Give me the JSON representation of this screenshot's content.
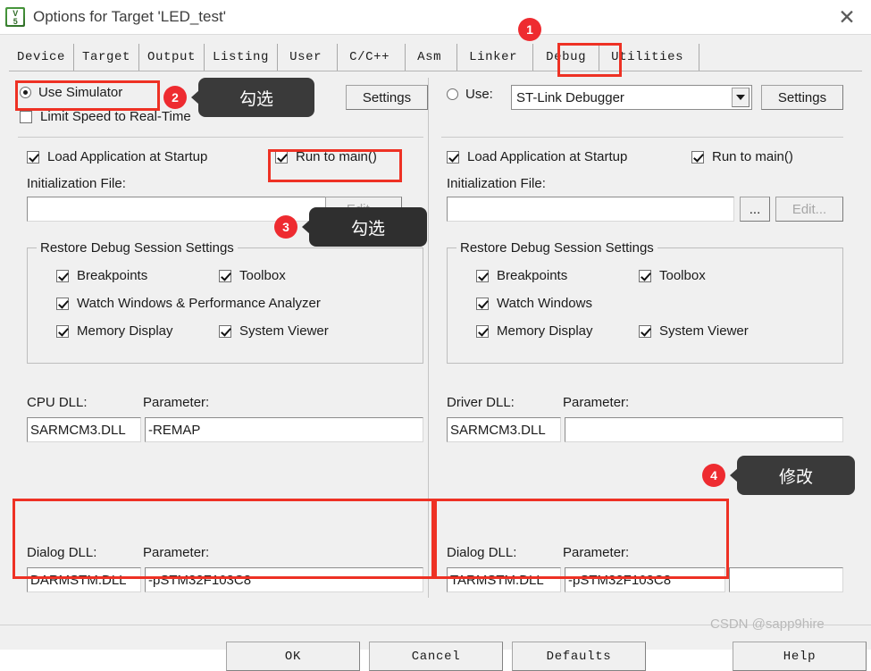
{
  "window": {
    "title": "Options for Target 'LED_test'",
    "app_icon": "keil-uvision-icon",
    "close_label": "✕"
  },
  "tabs": [
    {
      "label": "Device",
      "active": false
    },
    {
      "label": "Target",
      "active": false
    },
    {
      "label": "Output",
      "active": false
    },
    {
      "label": "Listing",
      "active": false
    },
    {
      "label": "User",
      "active": false
    },
    {
      "label": "C/C++",
      "active": false
    },
    {
      "label": "Asm",
      "active": false
    },
    {
      "label": "Linker",
      "active": false
    },
    {
      "label": "Debug",
      "active": true
    },
    {
      "label": "Utilities",
      "active": false
    }
  ],
  "left_panel": {
    "use_simulator": {
      "label": "Use Simulator",
      "checked": true
    },
    "limit_speed": {
      "label": "Limit Speed to Real-Time",
      "checked": false
    },
    "settings_button": "Settings",
    "load_app": {
      "label": "Load Application at Startup",
      "checked": true
    },
    "run_to_main": {
      "label": "Run to main()",
      "checked": true
    },
    "init_file_label": "Initialization File:",
    "init_file_value": "",
    "browse_button": "...",
    "edit_button": "Edit...",
    "restore_group": {
      "title": "Restore Debug Session Settings",
      "items": [
        {
          "label": "Breakpoints",
          "checked": true
        },
        {
          "label": "Toolbox",
          "checked": true
        },
        {
          "label": "Watch Windows & Performance Analyzer",
          "checked": true
        },
        {
          "label": "Memory Display",
          "checked": true
        },
        {
          "label": "System Viewer",
          "checked": true
        }
      ]
    },
    "cpu_dll_label": "CPU DLL:",
    "cpu_dll_value": "SARMCM3.DLL",
    "cpu_param_label": "Parameter:",
    "cpu_param_value": "-REMAP",
    "dialog_dll_label": "Dialog DLL:",
    "dialog_dll_value": "DARMSTM.DLL",
    "dialog_param_label": "Parameter:",
    "dialog_param_value": "-pSTM32F103C8"
  },
  "right_panel": {
    "use_radio": {
      "label": "Use:",
      "checked": false
    },
    "debugger_select": {
      "value": "ST-Link Debugger",
      "options": [
        "ST-Link Debugger"
      ]
    },
    "settings_button": "Settings",
    "load_app": {
      "label": "Load Application at Startup",
      "checked": true
    },
    "run_to_main": {
      "label": "Run to main()",
      "checked": true
    },
    "init_file_label": "Initialization File:",
    "init_file_value": "",
    "browse_button": "...",
    "edit_button": "Edit...",
    "restore_group": {
      "title": "Restore Debug Session Settings",
      "items": [
        {
          "label": "Breakpoints",
          "checked": true
        },
        {
          "label": "Toolbox",
          "checked": true
        },
        {
          "label": "Watch Windows",
          "checked": true
        },
        {
          "label": "Memory Display",
          "checked": true
        },
        {
          "label": "System Viewer",
          "checked": true
        }
      ]
    },
    "driver_dll_label": "Driver DLL:",
    "driver_dll_value": "SARMCM3.DLL",
    "driver_param_label": "Parameter:",
    "driver_param_value": "",
    "dialog_dll_label": "Dialog DLL:",
    "dialog_dll_value": "TARMSTM.DLL",
    "dialog_param_label": "Parameter:",
    "dialog_param_value": "-pSTM32F103C8",
    "extra_param_value": ""
  },
  "footer": {
    "ok": "OK",
    "cancel": "Cancel",
    "defaults": "Defaults",
    "help": "Help",
    "watermark": "CSDN @sapp9hire"
  },
  "annotations": [
    {
      "number": "1",
      "tip": ""
    },
    {
      "number": "2",
      "tip": "勾选"
    },
    {
      "number": "3",
      "tip": "勾选"
    },
    {
      "number": "4",
      "tip": "修改"
    }
  ],
  "colors": {
    "highlight_red": "#ee3124",
    "badge_red": "#ee2b30",
    "tooltip_dark": "#3a3a3a",
    "dialog_bg": "#f0f0f0"
  }
}
